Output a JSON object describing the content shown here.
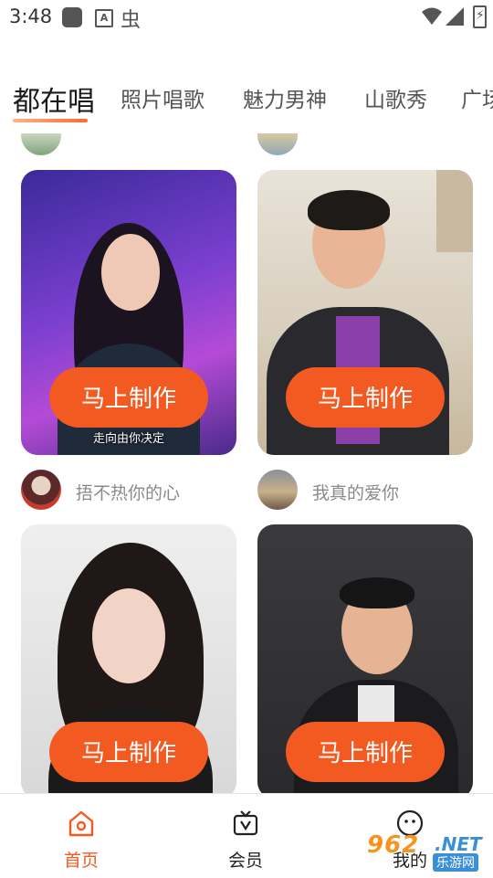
{
  "status_bar": {
    "time": "3:48",
    "icons": [
      "app-square-icon",
      "a-notification-icon",
      "bug-icon",
      "wifi-icon",
      "signal-icon",
      "battery-charging-icon"
    ]
  },
  "tabs": [
    {
      "label": "都在唱",
      "active": true
    },
    {
      "label": "照片唱歌",
      "active": false
    },
    {
      "label": "魅力男神",
      "active": false
    },
    {
      "label": "山歌秀",
      "active": false
    },
    {
      "label": "广场",
      "active": false
    }
  ],
  "cards": [
    {
      "button": "马上制作",
      "caption": "走向由你决定",
      "author": "捂不热你的心",
      "bg": "#5b2fb8"
    },
    {
      "button": "马上制作",
      "caption": "",
      "author": "我真的爱你",
      "bg": "#e9e2d6"
    },
    {
      "button": "马上制作",
      "caption": "",
      "author": "",
      "bg": "#d9d9d9"
    },
    {
      "button": "马上制作",
      "caption": "",
      "author": "",
      "bg": "#2f2f33"
    }
  ],
  "bottom_nav": {
    "items": [
      {
        "label": "首页",
        "icon": "home-icon",
        "active": true
      },
      {
        "label": "会员",
        "icon": "vip-tv-icon",
        "active": false
      },
      {
        "label": "我的",
        "icon": "profile-face-icon",
        "active": false
      }
    ]
  },
  "watermark": {
    "number": "962",
    "suffix": ".NET",
    "site": "乐游网"
  },
  "colors": {
    "accent": "#f25a22",
    "active_tab": "#1a1a1a",
    "muted_text": "#8a8a8a"
  }
}
